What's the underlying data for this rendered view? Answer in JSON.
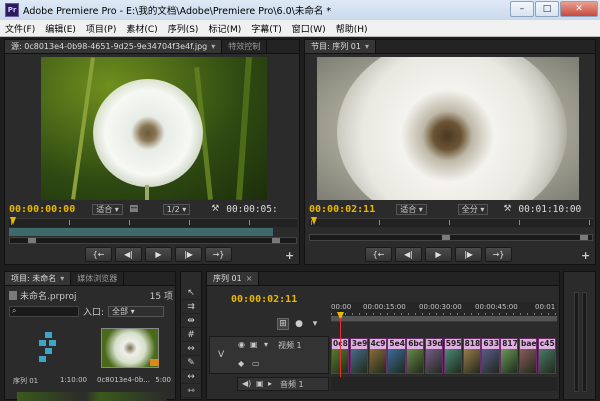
{
  "window": {
    "title": "Adobe Premiere Pro - E:\\我的文档\\Adobe\\Premiere Pro\\6.0\\未命名 *",
    "logo_text": "Pr",
    "minimize": "–",
    "maximize": "□",
    "close": "✕"
  },
  "menu": [
    "文件(F)",
    "编辑(E)",
    "项目(P)",
    "素材(C)",
    "序列(S)",
    "标记(M)",
    "字幕(T)",
    "窗口(W)",
    "帮助(H)"
  ],
  "source_monitor": {
    "tab_label": "源: 0c8013e4-0b98-4651-9d25-9e34704f3e4f.jpg",
    "tab2_label": "特效控制",
    "timecode": "00:00:00:00",
    "fit": "适合",
    "resolution": "1/2",
    "duration": "00:00:05:"
  },
  "program_monitor": {
    "tab_label": "节目: 序列 01",
    "timecode": "00:00:02:11",
    "fit": "适合",
    "resolution": "全分",
    "duration": "00:01:10:00"
  },
  "project_panel": {
    "tab_label": "项目: 未命名",
    "tab2_label": "媒体浏览器",
    "project_file": "未命名.prproj",
    "count": "15 项",
    "in_label": "入口:",
    "in_value": "全部",
    "items": [
      {
        "name": "序列 01",
        "duration": "1:10:00"
      },
      {
        "name": "0c8013e4-0b...",
        "duration": "5:00"
      }
    ]
  },
  "timeline": {
    "tab_label": "序列 01",
    "timecode": "00:00:02:11",
    "ruler_labels": [
      "00:00",
      "00:00:15:00",
      "00:00:30:00",
      "00:00:45:00",
      "00:01"
    ],
    "video_track": {
      "letter": "V",
      "name": "视频 1"
    },
    "audio_track": {
      "name": "音频 1"
    },
    "clips": [
      "0c8",
      "3e9",
      "4c9",
      "5e4",
      "6bc",
      "39d",
      "595",
      "818",
      "633",
      "817",
      "bae",
      "c45"
    ]
  },
  "colors": {
    "timecode_yellow": "#e8b800",
    "clip_pink": "#c08ec0",
    "playhead_red": "#e03030"
  },
  "icons": {
    "prev_marker": "{←",
    "step_back": "◀|",
    "play": "▶",
    "step_forward": "|▶",
    "next_marker": "→}",
    "wrench": "🔧"
  }
}
